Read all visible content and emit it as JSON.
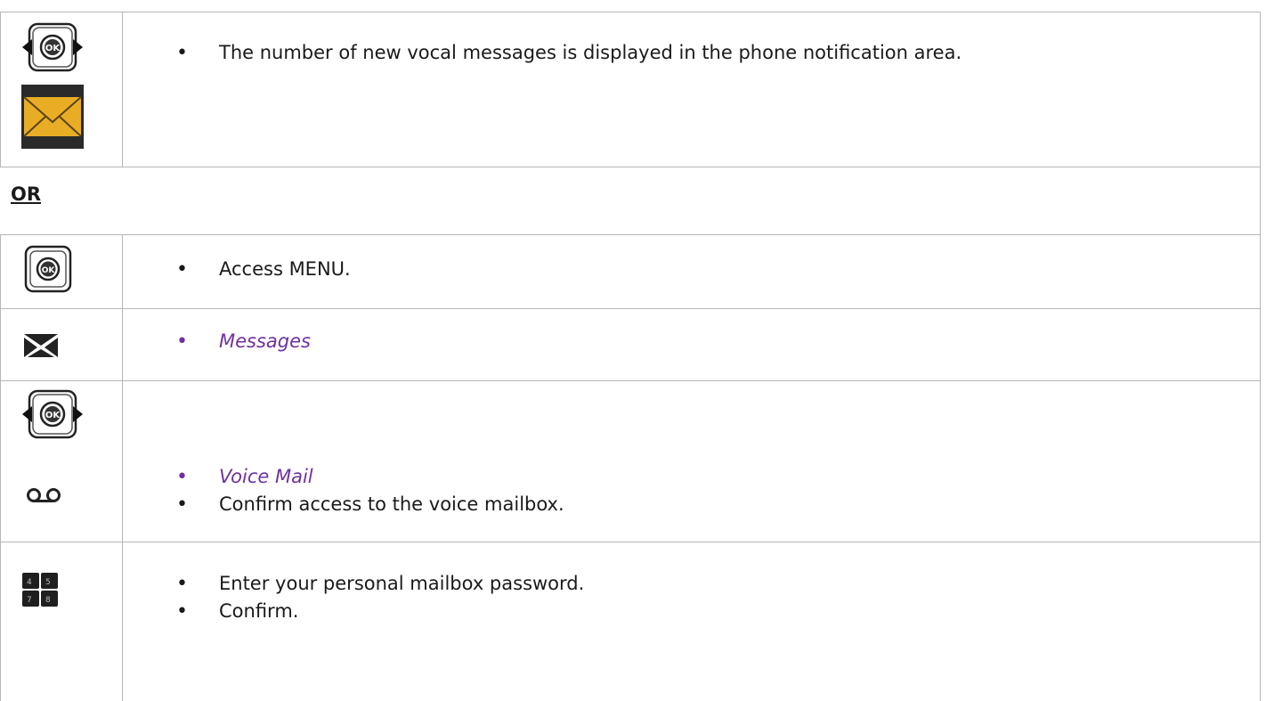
{
  "or_label": "OR",
  "rows": [
    {
      "icons": [
        "ok-navigator-icon",
        "envelope-notification-icon"
      ],
      "bullets": [
        {
          "text": "The number of new vocal messages is displayed in the phone notification area.",
          "style": "normal"
        }
      ]
    },
    {
      "icons": [
        "ok-key-icon"
      ],
      "bullets": [
        {
          "text": "Access MENU.",
          "style": "normal"
        }
      ]
    },
    {
      "icons": [
        "envelope-icon"
      ],
      "bullets": [
        {
          "text": "Messages",
          "style": "menu-item"
        }
      ]
    },
    {
      "icons": [
        "ok-navigator-icon",
        "voicemail-icon"
      ],
      "bullets": [
        {
          "text": "Voice Mail",
          "style": "menu-item"
        },
        {
          "text": "Confirm access to the voice mailbox.",
          "style": "normal"
        }
      ]
    },
    {
      "icons": [
        "keypad-icon"
      ],
      "bullets": [
        {
          "text": "Enter your personal mailbox password.",
          "style": "normal"
        },
        {
          "text": "Confirm.",
          "style": "normal"
        }
      ]
    }
  ],
  "keypad": {
    "keys": [
      "4",
      "5",
      "7",
      "8"
    ]
  },
  "colors": {
    "menu_item_text": "#7030a0",
    "border": "#b7b7b7",
    "envelope_notification": "#e8ad25"
  }
}
